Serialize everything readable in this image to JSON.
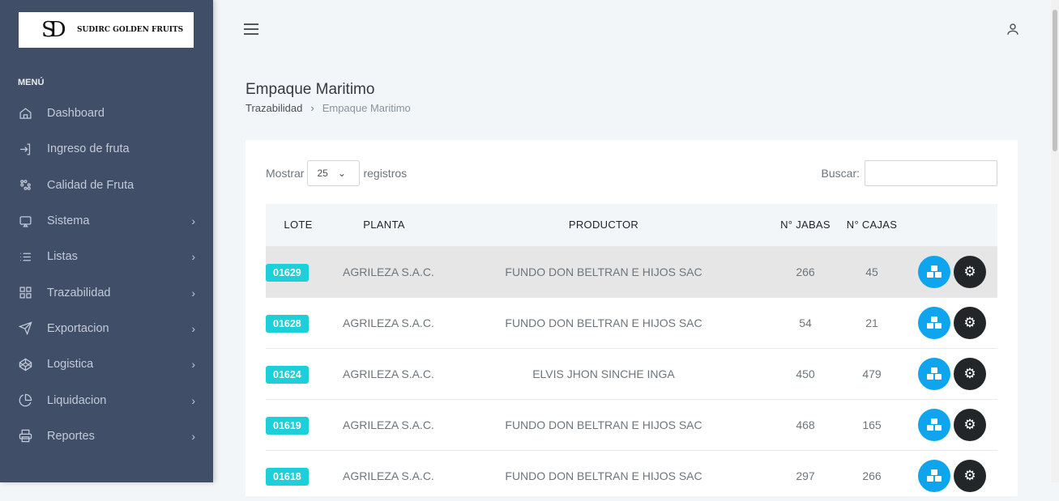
{
  "logo": {
    "mark": "SD",
    "text": "SUDIRC GOLDEN FRUITS"
  },
  "sidebar": {
    "title": "MENÚ",
    "items": [
      {
        "label": "Dashboard",
        "icon": "home-icon",
        "sub": false
      },
      {
        "label": "Ingreso de fruta",
        "icon": "login-icon",
        "sub": false
      },
      {
        "label": "Calidad de Fruta",
        "icon": "grid-dots-icon",
        "sub": false
      },
      {
        "label": "Sistema",
        "icon": "monitor-icon",
        "sub": true
      },
      {
        "label": "Listas",
        "icon": "list-icon",
        "sub": true
      },
      {
        "label": "Trazabilidad",
        "icon": "apps-icon",
        "sub": true
      },
      {
        "label": "Exportacion",
        "icon": "send-icon",
        "sub": true
      },
      {
        "label": "Logistica",
        "icon": "codepen-icon",
        "sub": true
      },
      {
        "label": "Liquidacion",
        "icon": "pie-chart-icon",
        "sub": true
      },
      {
        "label": "Reportes",
        "icon": "printer-icon",
        "sub": true
      }
    ]
  },
  "page": {
    "title": "Empaque Maritimo",
    "breadcrumb": [
      "Trazabilidad",
      "Empaque Maritimo"
    ]
  },
  "table_controls": {
    "show_label": "Mostrar",
    "page_size": "25",
    "records_label": "registros",
    "search_label": "Buscar:",
    "search_value": ""
  },
  "table": {
    "columns": [
      "LOTE",
      "PLANTA",
      "PRODUCTOR",
      "N° JABAS",
      "N° CAJAS",
      ""
    ],
    "rows": [
      [
        "01629",
        "AGRILEZA S.A.C.",
        "FUNDO DON BELTRAN E HIJOS SAC",
        "266",
        "45"
      ],
      [
        "01628",
        "AGRILEZA S.A.C.",
        "FUNDO DON BELTRAN E HIJOS SAC",
        "54",
        "21"
      ],
      [
        "01624",
        "AGRILEZA S.A.C.",
        "ELVIS JHON SINCHE INGA",
        "450",
        "479"
      ],
      [
        "01619",
        "AGRILEZA S.A.C.",
        "FUNDO DON BELTRAN E HIJOS SAC",
        "468",
        "165"
      ],
      [
        "01618",
        "AGRILEZA S.A.C.",
        "FUNDO DON BELTRAN E HIJOS SAC",
        "297",
        "266"
      ]
    ]
  },
  "colors": {
    "sidebar": "#404e67",
    "badge": "#1dcfd8",
    "primary": "#0ea5ee",
    "dark": "#232629"
  }
}
